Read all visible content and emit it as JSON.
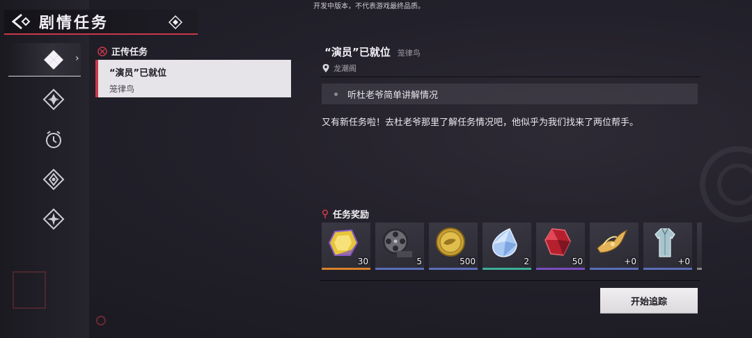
{
  "notice": "开发中版本，不代表游戏最终品质。",
  "header": {
    "title": "剧情任务"
  },
  "sidebar": {
    "items": [
      {
        "name": "main-story",
        "icon": "four-diamond-icon",
        "active": true
      },
      {
        "name": "side-story",
        "icon": "compass-diamond-icon",
        "active": false
      },
      {
        "name": "timed",
        "icon": "clock-icon",
        "active": false
      },
      {
        "name": "event",
        "icon": "arrow-diamond-icon",
        "active": false
      },
      {
        "name": "special",
        "icon": "star-diamond-icon",
        "active": false
      }
    ]
  },
  "quest_list": {
    "category": "正传任务",
    "items": [
      {
        "title": "“演员”已就位",
        "subtitle": "笼律鸟"
      }
    ]
  },
  "detail": {
    "title": "“演员”已就位",
    "npc": "笼律鸟",
    "location": "龙潮阁",
    "objective": "听杜老爷简单讲解情况",
    "description": "又有新任务啦！去杜老爷那里了解任务情况吧，他似乎为我们找来了两位帮手。"
  },
  "rewards": {
    "title": "任务奖励",
    "items": [
      {
        "icon": "yellow-gem-icon",
        "count": "30",
        "rarity_color": "#d9822b"
      },
      {
        "icon": "film-reel-icon",
        "count": "5",
        "rarity_color": "#5a6fb8"
      },
      {
        "icon": "gold-coin-icon",
        "count": "500",
        "rarity_color": "#5a6fb8"
      },
      {
        "icon": "blue-crystal-icon",
        "count": "2",
        "rarity_color": "#3fae9a"
      },
      {
        "icon": "red-gem-icon",
        "count": "50",
        "rarity_color": "#7a4fc0"
      },
      {
        "icon": "golden-phoenix-icon",
        "count": "+0",
        "rarity_color": "#5a6fb8"
      },
      {
        "icon": "outfit-icon",
        "count": "+0",
        "rarity_color": "#5a6fb8"
      }
    ]
  },
  "actions": {
    "track_label": "开始追踪"
  },
  "colors": {
    "accent": "#c8394a",
    "panel": "#23212a",
    "card": "#e6e4e8"
  }
}
